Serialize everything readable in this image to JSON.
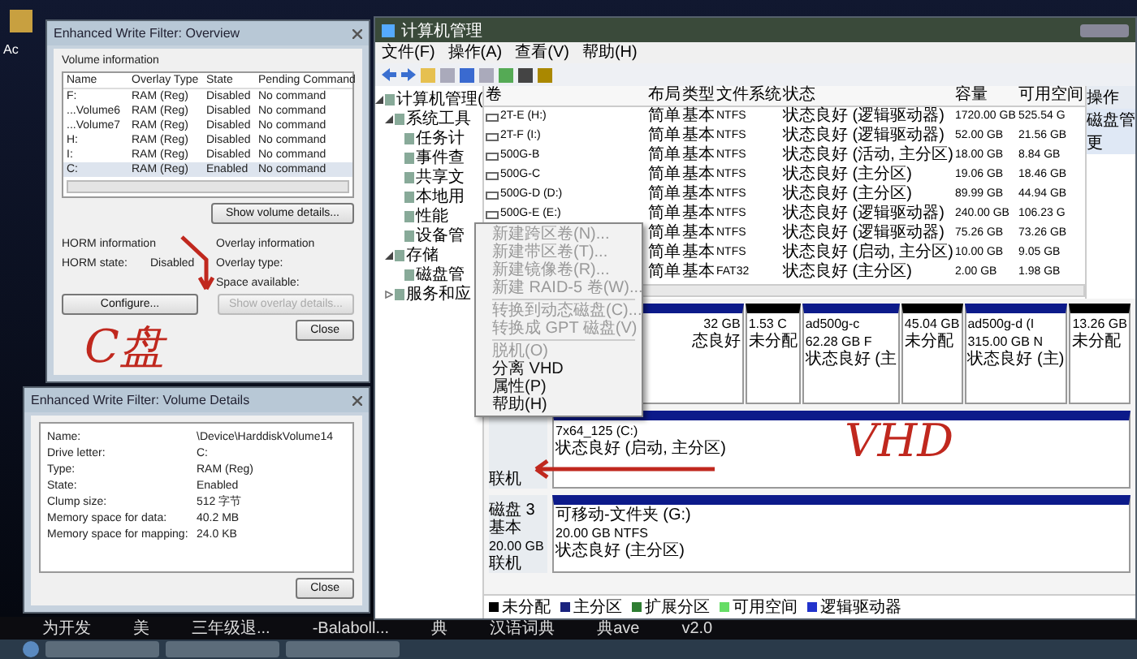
{
  "desktop": {
    "icon_label": "Ac",
    "strip_texts": [
      "为开发",
      "美",
      "三年级退...",
      "-Balaboll...",
      "典",
      "汉语词典",
      "典ave",
      "v2.0"
    ]
  },
  "ewf_overview": {
    "title": "Enhanced Write Filter: Overview",
    "group_title": "Volume information",
    "columns": [
      "Name",
      "Overlay Type",
      "State",
      "Pending Command"
    ],
    "rows": [
      {
        "cells": [
          "F:",
          "RAM (Reg)",
          "Disabled",
          "No command"
        ],
        "selected": false
      },
      {
        "cells": [
          "...Volume6",
          "RAM (Reg)",
          "Disabled",
          "No command"
        ],
        "selected": false
      },
      {
        "cells": [
          "...Volume7",
          "RAM (Reg)",
          "Disabled",
          "No command"
        ],
        "selected": false
      },
      {
        "cells": [
          "H:",
          "RAM (Reg)",
          "Disabled",
          "No command"
        ],
        "selected": false
      },
      {
        "cells": [
          "I:",
          "RAM (Reg)",
          "Disabled",
          "No command"
        ],
        "selected": false
      },
      {
        "cells": [
          "C:",
          "RAM (Reg)",
          "Enabled",
          "No command"
        ],
        "selected": true
      }
    ],
    "details_button": "Show volume details...",
    "horm_title": "HORM information",
    "horm_label": "HORM state:",
    "horm_value": "Disabled",
    "overlay_title": "Overlay information",
    "overlay_type_label": "Overlay type:",
    "space_label": "Space available:",
    "configure_button": "Configure...",
    "overlay_button": {
      "label": "Show overlay details...",
      "disabled": true
    },
    "close_button": "Close"
  },
  "ewf_details": {
    "title": "Enhanced Write Filter: Volume Details",
    "fields": [
      {
        "label": "Name:",
        "value": "\\Device\\HarddiskVolume14"
      },
      {
        "label": "Drive letter:",
        "value": "C:"
      },
      {
        "label": "Type:",
        "value": "RAM (Reg)"
      },
      {
        "label": "State:",
        "value": "Enabled"
      },
      {
        "label": "Clump size:",
        "value": "512 字节"
      },
      {
        "label": "Memory space for data:",
        "value": "40.2 MB"
      },
      {
        "label": "Memory space for mapping:",
        "value": "24.0 KB"
      }
    ],
    "close_button": "Close"
  },
  "computer_management": {
    "title": "计算机管理",
    "menu": [
      "文件(F)",
      "操作(A)",
      "查看(V)",
      "帮助(H)"
    ],
    "tree": [
      {
        "label": "计算机管理(",
        "expanded": true,
        "children": [
          {
            "label": "系统工具",
            "expanded": true,
            "children": [
              {
                "label": "任务计"
              },
              {
                "label": "事件查"
              },
              {
                "label": "共享文"
              },
              {
                "label": "本地用"
              },
              {
                "label": "性能"
              },
              {
                "label": "设备管"
              }
            ]
          },
          {
            "label": "存储",
            "expanded": true,
            "children": [
              {
                "label": "磁盘管"
              }
            ]
          },
          {
            "label": "服务和应",
            "expanded": false
          }
        ]
      }
    ],
    "columns": [
      "卷",
      "布局",
      "类型",
      "文件系统",
      "状态",
      "容量",
      "可用空间"
    ],
    "rows": [
      {
        "cells": [
          "2T-E (H:)",
          "简单",
          "基本",
          "NTFS",
          "状态良好 (逻辑驱动器)",
          "1720.00 GB",
          "525.54 G"
        ]
      },
      {
        "cells": [
          "2T-F (I:)",
          "简单",
          "基本",
          "NTFS",
          "状态良好 (逻辑驱动器)",
          "52.00 GB",
          "21.56 GB"
        ]
      },
      {
        "cells": [
          "500G-B",
          "简单",
          "基本",
          "NTFS",
          "状态良好 (活动, 主分区)",
          "18.00 GB",
          "8.84 GB"
        ]
      },
      {
        "cells": [
          "500G-C",
          "简单",
          "基本",
          "NTFS",
          "状态良好 (主分区)",
          "19.06 GB",
          "18.46 GB"
        ]
      },
      {
        "cells": [
          "500G-D (D:)",
          "简单",
          "基本",
          "NTFS",
          "状态良好 (主分区)",
          "89.99 GB",
          "44.94 GB"
        ]
      },
      {
        "cells": [
          "500G-E (E:)",
          "简单",
          "基本",
          "NTFS",
          "状态良好 (逻辑驱动器)",
          "240.00 GB",
          "106.23 G"
        ]
      },
      {
        "cells": [
          "",
          "简单",
          "基本",
          "NTFS",
          "状态良好 (逻辑驱动器)",
          "75.26 GB",
          "73.26 GB"
        ]
      },
      {
        "cells": [
          "",
          "简单",
          "基本",
          "NTFS",
          "状态良好 (启动, 主分区)",
          "10.00 GB",
          "9.05 GB"
        ]
      },
      {
        "cells": [
          "",
          "简单",
          "基本",
          "FAT32",
          "状态良好 (主分区)",
          "2.00 GB",
          "1.98 GB"
        ]
      }
    ],
    "disks": [
      {
        "partitions": [
          {
            "kind": "primary",
            "lines": [
              "32 GB",
              "态良好"
            ]
          },
          {
            "kind": "unallocated",
            "lines": [
              "1.53 C",
              "未分配"
            ]
          },
          {
            "kind": "primary",
            "lines": [
              "ad500g-c",
              "62.28 GB F",
              "状态良好 (主"
            ]
          },
          {
            "kind": "unallocated",
            "lines": [
              "45.04 GB",
              "未分配"
            ]
          },
          {
            "kind": "primary",
            "lines": [
              "ad500g-d (I",
              "315.00 GB N",
              "状态良好 (主)"
            ]
          },
          {
            "kind": "unallocated",
            "lines": [
              "13.26 GB",
              "未分配"
            ]
          }
        ]
      },
      {
        "label": [
          "联机"
        ],
        "partitions": [
          {
            "kind": "primary",
            "lines": [
              "7x64_125 (C:)",
              "状态良好 (启动, 主分区)"
            ]
          }
        ]
      },
      {
        "label": [
          "磁盘 3",
          "基本",
          "20.00 GB",
          "联机"
        ],
        "partitions": [
          {
            "kind": "primary",
            "lines": [
              "可移动-文件夹 (G:)",
              "20.00 GB NTFS",
              "状态良好 (主分区)"
            ]
          }
        ]
      }
    ],
    "legend": [
      {
        "label": "未分配",
        "color": "#000000"
      },
      {
        "label": "主分区",
        "color": "#1a237e"
      },
      {
        "label": "扩展分区",
        "color": "#2e7d32"
      },
      {
        "label": "可用空间",
        "color": "#66dd66"
      },
      {
        "label": "逻辑驱动器",
        "color": "#2233cc"
      }
    ],
    "actions": {
      "title": "操作",
      "items": [
        "磁盘管",
        "更"
      ]
    }
  },
  "context_menu": {
    "items": [
      {
        "kind": "item",
        "label": "新建跨区卷(N)...",
        "disabled": true
      },
      {
        "kind": "item",
        "label": "新建带区卷(T)...",
        "disabled": true
      },
      {
        "kind": "item",
        "label": "新建镜像卷(R)...",
        "disabled": true
      },
      {
        "kind": "item",
        "label": "新建 RAID-5 卷(W)...",
        "disabled": true
      },
      {
        "kind": "separator"
      },
      {
        "kind": "item",
        "label": "转换到动态磁盘(C)...",
        "disabled": true
      },
      {
        "kind": "item",
        "label": "转换成 GPT 磁盘(V)",
        "disabled": true
      },
      {
        "kind": "separator"
      },
      {
        "kind": "item",
        "label": "脱机(O)",
        "disabled": true
      },
      {
        "kind": "item",
        "label": "分离 VHD",
        "disabled": false
      },
      {
        "kind": "item",
        "label": "属性(P)",
        "disabled": false
      },
      {
        "kind": "item",
        "label": "帮助(H)",
        "disabled": false
      }
    ]
  },
  "annotations": [
    "C盘",
    "VHD"
  ]
}
